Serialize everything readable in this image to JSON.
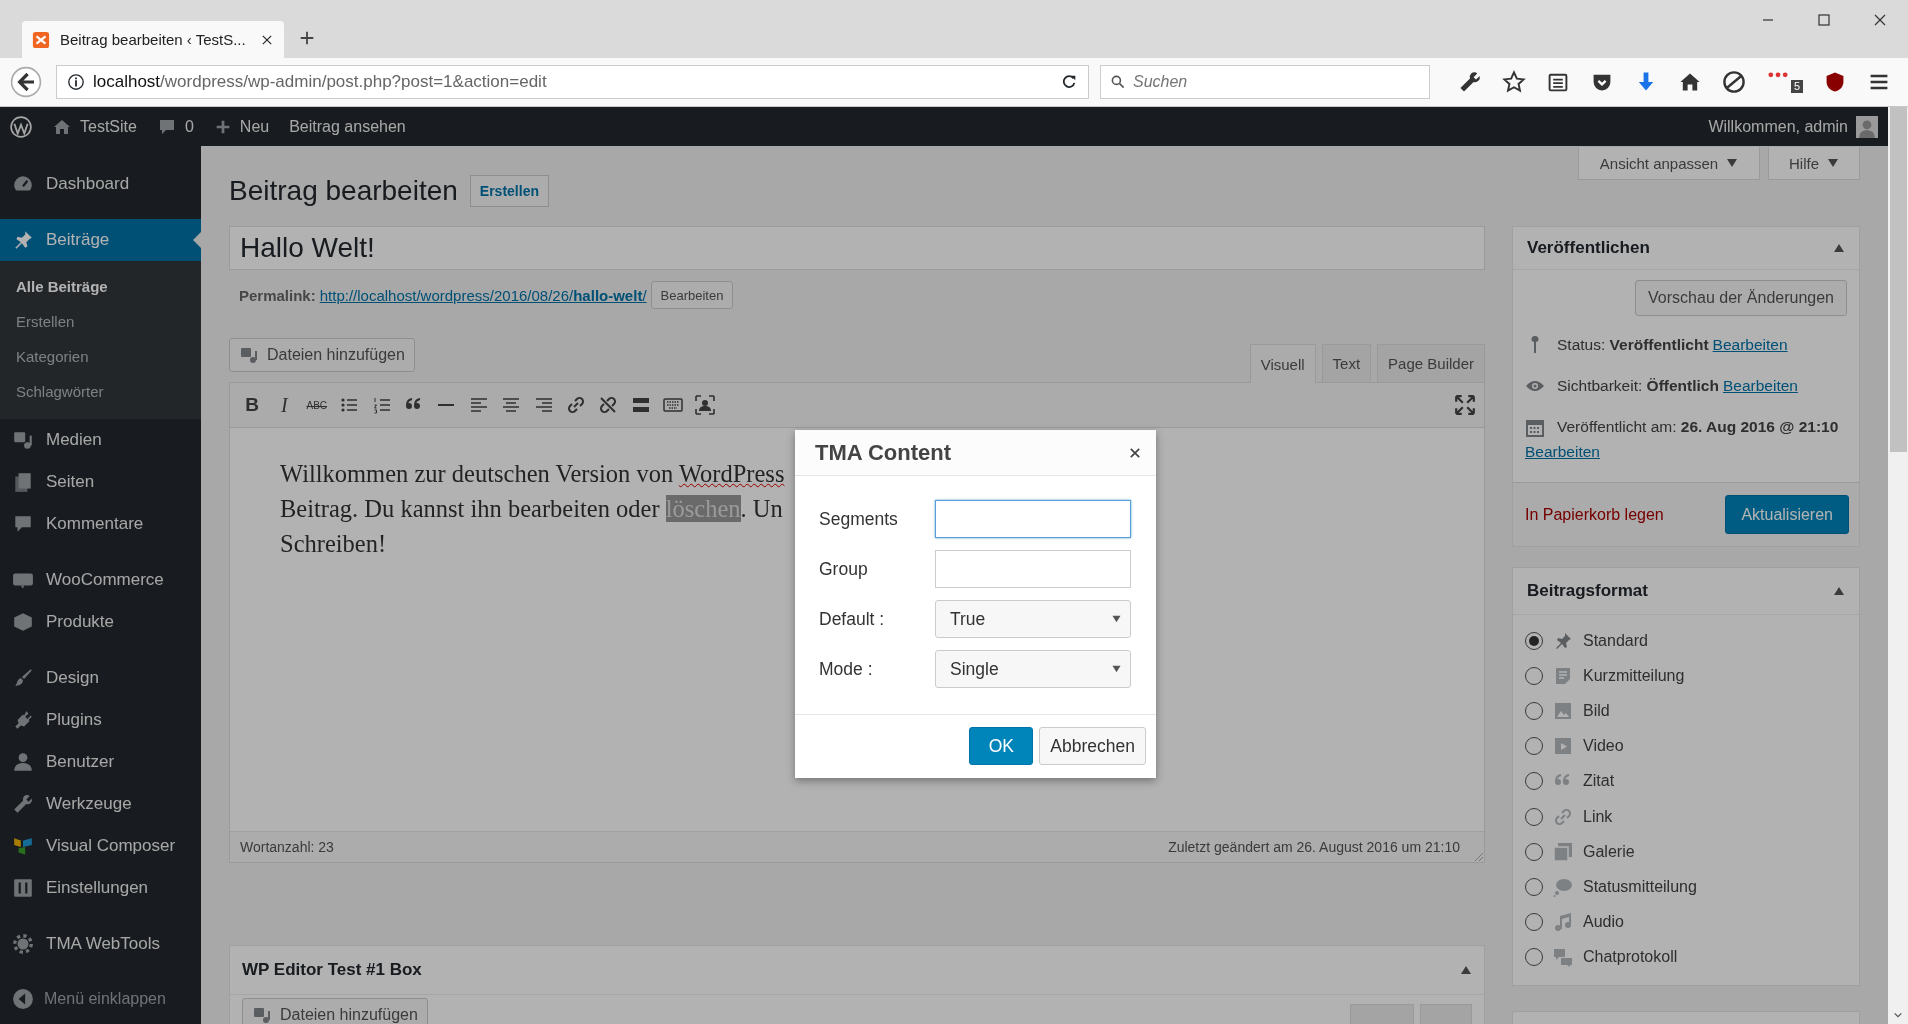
{
  "browser": {
    "tab": {
      "title": "Beitrag bearbeiten ‹ TestS...",
      "selected": true
    },
    "url": {
      "host": "localhost",
      "path": "/wordpress/wp-admin/post.php?post=1&action=edit"
    },
    "search": {
      "placeholder": "Suchen"
    },
    "badge": "5"
  },
  "admin_bar": {
    "site": "TestSite",
    "comments": "0",
    "new": "Neu",
    "view": "Beitrag ansehen",
    "account": "Willkommen, admin"
  },
  "sidebar": {
    "groups": [
      [
        {
          "label": "Dashboard",
          "selected": false
        }
      ],
      [
        {
          "label": "Beiträge",
          "selected": true,
          "children": [
            {
              "label": "Alle Beiträge",
              "selected": true
            },
            {
              "label": "Erstellen",
              "selected": false
            },
            {
              "label": "Kategorien",
              "selected": false
            },
            {
              "label": "Schlagwörter",
              "selected": false
            }
          ]
        },
        {
          "label": "Medien",
          "selected": false
        },
        {
          "label": "Seiten",
          "selected": false
        },
        {
          "label": "Kommentare",
          "selected": false
        }
      ],
      [
        {
          "label": "WooCommerce",
          "selected": false
        },
        {
          "label": "Produkte",
          "selected": false
        }
      ],
      [
        {
          "label": "Design",
          "selected": false
        },
        {
          "label": "Plugins",
          "selected": false
        },
        {
          "label": "Benutzer",
          "selected": false
        },
        {
          "label": "Werkzeuge",
          "selected": false
        },
        {
          "label": "Visual Composer",
          "selected": false
        },
        {
          "label": "Einstellungen",
          "selected": false
        }
      ],
      [
        {
          "label": "TMA WebTools",
          "selected": false
        }
      ]
    ],
    "collapse": "Menü einklappen"
  },
  "screen_options": [
    "Ansicht anpassen",
    "Hilfe"
  ],
  "page": {
    "heading": "Beitrag bearbeiten",
    "add_new": "Erstellen",
    "title": "Hallo Welt!",
    "permalink": {
      "label": "Permalink:",
      "url": "http://localhost/wordpress/2016/08/26/**hallo-welt**/",
      "button": "Bearbeiten"
    },
    "add_media": "Dateien hinzufügen",
    "editor_tabs": [
      {
        "label": "Visuell",
        "selected": true
      },
      {
        "label": "Text",
        "selected": false
      },
      {
        "label": "Page Builder",
        "selected": false
      }
    ],
    "toolbar": [
      {
        "kind": "bold",
        "glyph": "B"
      },
      {
        "kind": "italic",
        "glyph": "I"
      },
      {
        "kind": "strike",
        "glyph": "ABC"
      },
      {
        "kind": "bullets"
      },
      {
        "kind": "numbers"
      },
      {
        "kind": "quote"
      },
      {
        "kind": "hr"
      },
      {
        "kind": "align-left"
      },
      {
        "kind": "align-center"
      },
      {
        "kind": "align-right"
      },
      {
        "kind": "link"
      },
      {
        "kind": "unlink"
      },
      {
        "kind": "more"
      },
      {
        "kind": "keyboard"
      },
      {
        "kind": "person"
      }
    ],
    "content": [
      [
        {
          "text": "Willkommen zur deutschen Version von ",
          "selected": false,
          "misspelled": false
        },
        {
          "text": "WordPress",
          "selected": false,
          "misspelled": true
        }
      ],
      [
        {
          "text": "Beitrag. Du kannst ihn bearbeiten oder ",
          "selected": false,
          "misspelled": false
        },
        {
          "text": "löschen",
          "selected": true,
          "misspelled": false
        },
        {
          "text": ". Un",
          "selected": false,
          "misspelled": false
        }
      ],
      [
        {
          "text": "Schreiben!",
          "selected": false,
          "misspelled": false
        }
      ]
    ],
    "word_count": "Wortanzahl: 23",
    "last_edited": "Zuletzt geändert am 26. August 2016 um 21:10",
    "metabox": {
      "title": "WP Editor Test #1 Box",
      "add_media": "Dateien hinzufügen"
    }
  },
  "publish": {
    "title": "Veröffentlichen",
    "preview": "Vorschau der Änderungen",
    "rows": [
      {
        "text": "Status: **Veröffentlicht**",
        "link": "Bearbeiten"
      },
      {
        "text": "Sichtbarkeit: **Öffentlich**",
        "link": "Bearbeiten"
      },
      {
        "text": "Veröffentlicht am: **26. Aug 2016 @ 21:10**",
        "link": "Bearbeiten"
      }
    ],
    "trash": "In Papierkorb legen",
    "update": "Aktualisieren"
  },
  "format": {
    "title": "Beitragsformat",
    "options": [
      {
        "label": "Standard",
        "selected": true
      },
      {
        "label": "Kurzmitteilung",
        "selected": false
      },
      {
        "label": "Bild",
        "selected": false
      },
      {
        "label": "Video",
        "selected": false
      },
      {
        "label": "Zitat",
        "selected": false
      },
      {
        "label": "Link",
        "selected": false
      },
      {
        "label": "Galerie",
        "selected": false
      },
      {
        "label": "Statusmitteilung",
        "selected": false
      },
      {
        "label": "Audio",
        "selected": false
      },
      {
        "label": "Chatprotokoll",
        "selected": false
      }
    ]
  },
  "dialog": {
    "title": "TMA Content",
    "fields": [
      {
        "label": "Segments",
        "kind": "text",
        "focused": true
      },
      {
        "label": "Group",
        "kind": "text",
        "focused": false
      },
      {
        "label": "Default :",
        "kind": "select",
        "value": "True"
      },
      {
        "label": "Mode :",
        "kind": "select",
        "value": "Single"
      }
    ],
    "buttons": [
      {
        "label": "OK",
        "primary": true
      },
      {
        "label": "Abbrechen",
        "primary": false
      }
    ]
  }
}
